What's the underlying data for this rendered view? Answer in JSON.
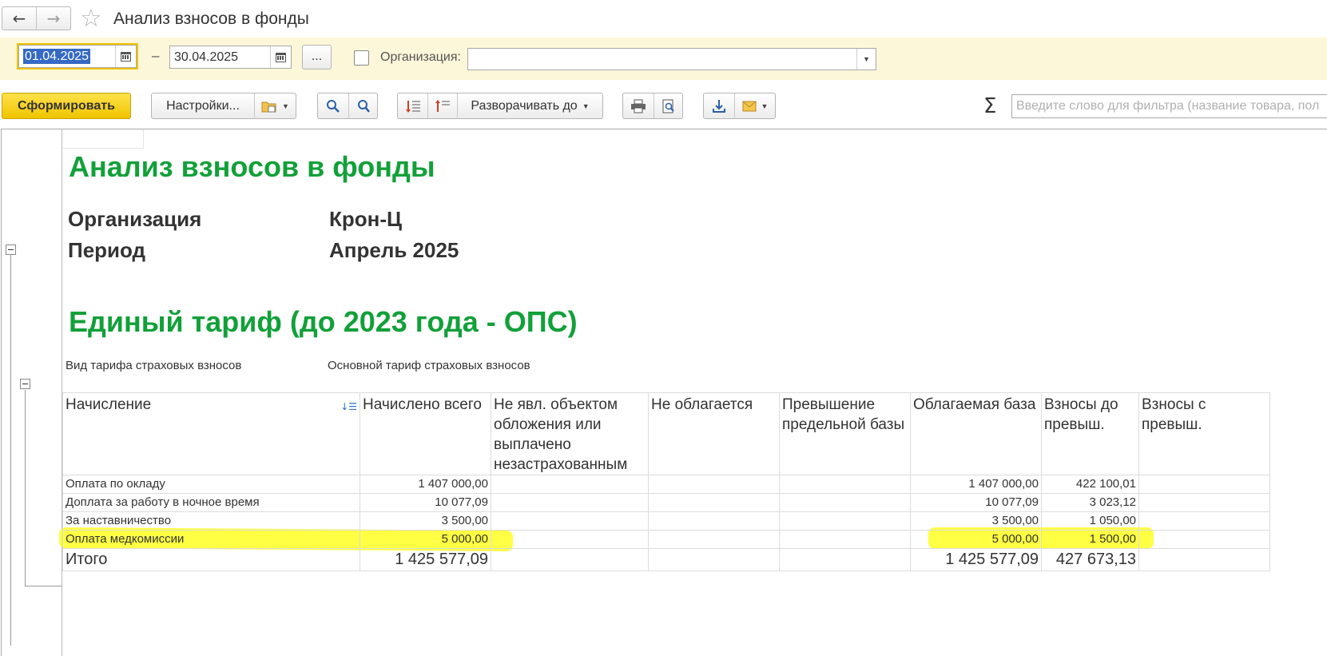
{
  "window": {
    "title": "Анализ взносов в фонды",
    "back_icon": "←",
    "forward_icon": "→",
    "star_icon": "☆"
  },
  "filters": {
    "date_from": "01.04.2025",
    "dash": "–",
    "date_to": "30.04.2025",
    "more_label": "...",
    "org_label": "Организация:",
    "org_value": ""
  },
  "toolbar": {
    "generate_label": "Сформировать",
    "settings_label": "Настройки...",
    "expand_label": "Разворачивать до",
    "sigma": "Σ",
    "filter_placeholder": "Введите слово для фильтра (название товара, пол"
  },
  "report": {
    "title": "Анализ взносов в фонды",
    "org_label": "Организация",
    "org_value": "Крон-Ц",
    "period_label": "Период",
    "period_value": "Апрель 2025",
    "section_title": "Единый тариф (до 2023 года - ОПС)",
    "tariff_label": "Вид тарифа страховых взносов",
    "tariff_value": "Основной тариф страховых взносов"
  },
  "table": {
    "headers": [
      "Начисление",
      "Начислено всего",
      "Не явл. объектом обложения или выплачено незастрахованным",
      "Не облагается",
      "Превышение предельной базы",
      "Облагаемая база",
      "Взносы до превыш.",
      "Взносы с превыш."
    ],
    "rows": [
      [
        "Оплата по окладу",
        "1 407 000,00",
        "",
        "",
        "",
        "1 407 000,00",
        "422 100,01",
        ""
      ],
      [
        "Доплата за работу в ночное время",
        "10 077,09",
        "",
        "",
        "",
        "10 077,09",
        "3 023,12",
        ""
      ],
      [
        "За наставничество",
        "3 500,00",
        "",
        "",
        "",
        "3 500,00",
        "1 050,00",
        ""
      ],
      [
        "Оплата медкомиссии",
        "5 000,00",
        "",
        "",
        "",
        "5 000,00",
        "1 500,00",
        ""
      ]
    ],
    "total": [
      "Итого",
      "1 425 577,09",
      "",
      "",
      "",
      "1 425 577,09",
      "427 673,13",
      ""
    ]
  },
  "colors": {
    "accent_yellow": "#f0c400",
    "filter_bar_bg": "#fcf7d9",
    "report_title_green": "#12a039",
    "highlight_yellow": "#ffff22"
  }
}
